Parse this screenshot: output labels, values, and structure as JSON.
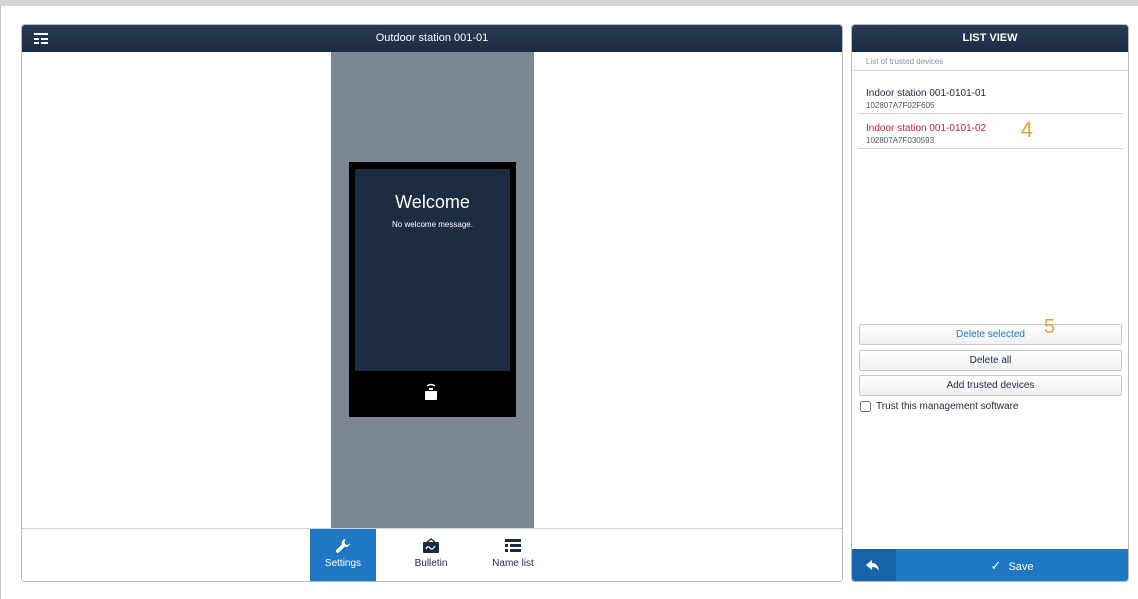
{
  "left_panel": {
    "title": "Outdoor station 001-01",
    "preview": {
      "welcome_title": "Welcome",
      "welcome_message": "No welcome message."
    },
    "tabs": [
      {
        "label": "Settings",
        "icon": "wrench-icon",
        "active": true
      },
      {
        "label": "Bulletin",
        "icon": "bulletin-icon",
        "active": false
      },
      {
        "label": "Name list",
        "icon": "name-list-icon",
        "active": false
      }
    ]
  },
  "right_panel": {
    "title": "LIST VIEW",
    "list_caption": "List of trusted devices",
    "devices": [
      {
        "name": "Indoor station 001-0101-01",
        "id": "102807A7F02F605",
        "selected": false
      },
      {
        "name": "Indoor station 001-0101-02",
        "id": "102807A7F030593",
        "selected": true
      }
    ],
    "annotation_4": "4",
    "buttons": {
      "delete_selected": "Delete selected",
      "delete_all": "Delete all",
      "add_trusted": "Add trusted devices"
    },
    "annotation_5": "5",
    "trust_label": "Trust this management software",
    "trust_checked": false,
    "save_label": "Save"
  },
  "colors": {
    "header": "#1b2b42",
    "accent": "#1f78c4",
    "selected_text": "#c8222b",
    "annotation": "#d8a93a",
    "preview_bg": "#7d8791"
  }
}
